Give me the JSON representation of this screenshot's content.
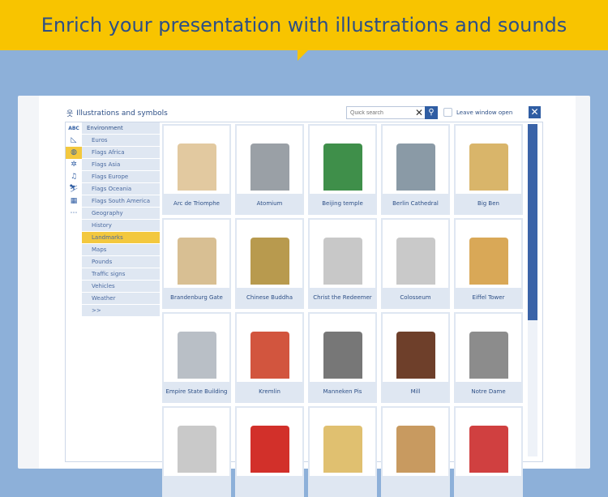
{
  "banner": {
    "text": "Enrich your presentation with illustrations and sounds"
  },
  "window": {
    "title": "Illustrations and symbols",
    "search_placeholder": "Quick search",
    "leave_open_label": "Leave window open"
  },
  "sidebar": {
    "icons": [
      "abc-icon",
      "geometry-icon",
      "globe-icon",
      "frog-icon",
      "music-icon",
      "sport-icon",
      "calendar-icon",
      "more-icon"
    ],
    "abc_label": "ABC",
    "selected_icon": "globe-icon",
    "items": [
      {
        "label": "Environment"
      },
      {
        "label": "Euros"
      },
      {
        "label": "Flags Africa"
      },
      {
        "label": "Flags Asia"
      },
      {
        "label": "Flags Europe"
      },
      {
        "label": "Flags Oceania"
      },
      {
        "label": "Flags South America"
      },
      {
        "label": "Geography"
      },
      {
        "label": "History"
      },
      {
        "label": "Landmarks"
      },
      {
        "label": "Maps"
      },
      {
        "label": "Pounds"
      },
      {
        "label": "Traffic signs"
      },
      {
        "label": "Vehicles"
      },
      {
        "label": "Weather"
      },
      {
        "label": ">>"
      }
    ],
    "selected": "Landmarks"
  },
  "grid": {
    "items": [
      {
        "label": "Arc de Triomphe",
        "color": "#e2c9a0"
      },
      {
        "label": "Atomium",
        "color": "#9aa0a6"
      },
      {
        "label": "Beijing temple",
        "color": "#3f8f4a"
      },
      {
        "label": "Berlin Cathedral",
        "color": "#8a9aa6"
      },
      {
        "label": "Big Ben",
        "color": "#d9b56a"
      },
      {
        "label": "Brandenburg Gate",
        "color": "#d8bf93"
      },
      {
        "label": "Chinese Buddha",
        "color": "#b89a4e"
      },
      {
        "label": "Christ the Redeemer",
        "color": "#c8c8c8"
      },
      {
        "label": "Colosseum",
        "color": "#c9c9c9"
      },
      {
        "label": "Eiffel Tower",
        "color": "#d9a857"
      },
      {
        "label": "Empire State Building",
        "color": "#b9bfc6"
      },
      {
        "label": "Kremlin",
        "color": "#d2553e"
      },
      {
        "label": "Manneken Pis",
        "color": "#777"
      },
      {
        "label": "Mill",
        "color": "#6e3f2a"
      },
      {
        "label": "Notre Dame",
        "color": "#8c8c8c"
      },
      {
        "label": "",
        "color": "#c9c9c9"
      },
      {
        "label": "",
        "color": "#d2302a"
      },
      {
        "label": "",
        "color": "#e0c070"
      },
      {
        "label": "",
        "color": "#c89a60"
      },
      {
        "label": "",
        "color": "#d04040"
      }
    ]
  }
}
